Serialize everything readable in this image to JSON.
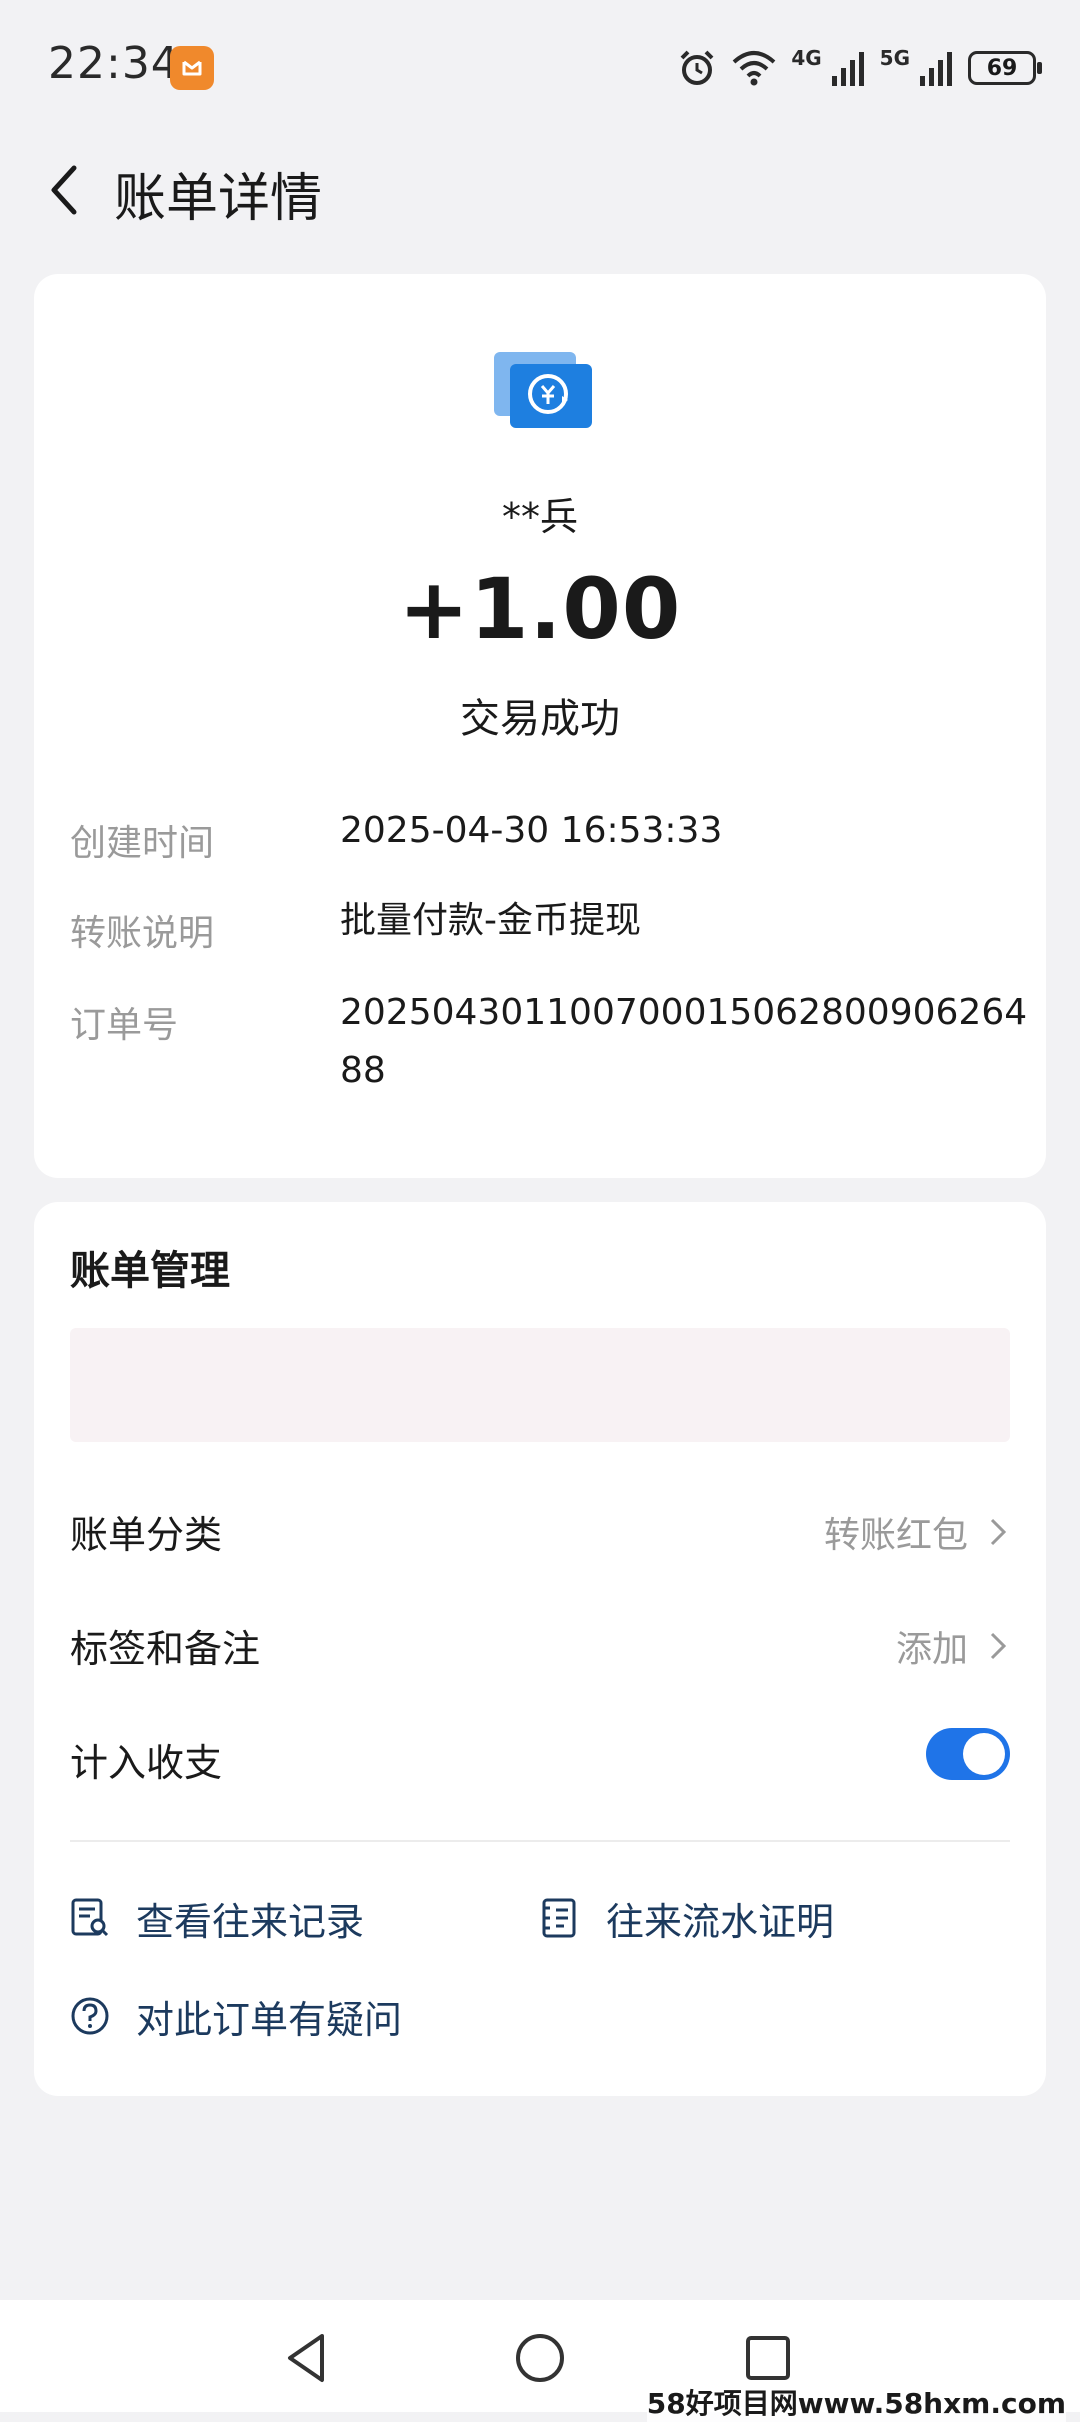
{
  "status_bar": {
    "time": "22:34",
    "net_4g": "4G",
    "net_5g": "5G",
    "battery": "69",
    "icons": [
      "notification-app-icon",
      "alarm-icon",
      "wifi-icon",
      "signal-4g-icon",
      "signal-5g-icon",
      "battery-icon"
    ]
  },
  "header": {
    "back_icon": "back-arrow-icon",
    "title": "账单详情"
  },
  "detail": {
    "icon": "transfer-yuan-icon",
    "payee": "**兵",
    "amount": "+1.00",
    "status": "交易成功",
    "rows": [
      {
        "label": "创建时间",
        "value": "2025-04-30 16:53:33"
      },
      {
        "label": "转账说明",
        "value": "批量付款-金币提现"
      },
      {
        "label": "订单号",
        "value": "20250430110070001506280090626488"
      }
    ]
  },
  "manage": {
    "title": "账单管理",
    "category_label": "账单分类",
    "category_value": "转账红包",
    "tag_label": "标签和备注",
    "tag_value": "添加",
    "count_label": "计入收支",
    "count_enabled": true,
    "links": {
      "history": "查看往来记录",
      "proof": "往来流水证明",
      "question": "对此订单有疑问"
    },
    "accent_color": "#1f74e8"
  },
  "navbar": {
    "icons": [
      "back-triangle-icon",
      "home-circle-icon",
      "recents-square-icon"
    ]
  },
  "watermark": "58好项目网www.58hxm.com"
}
